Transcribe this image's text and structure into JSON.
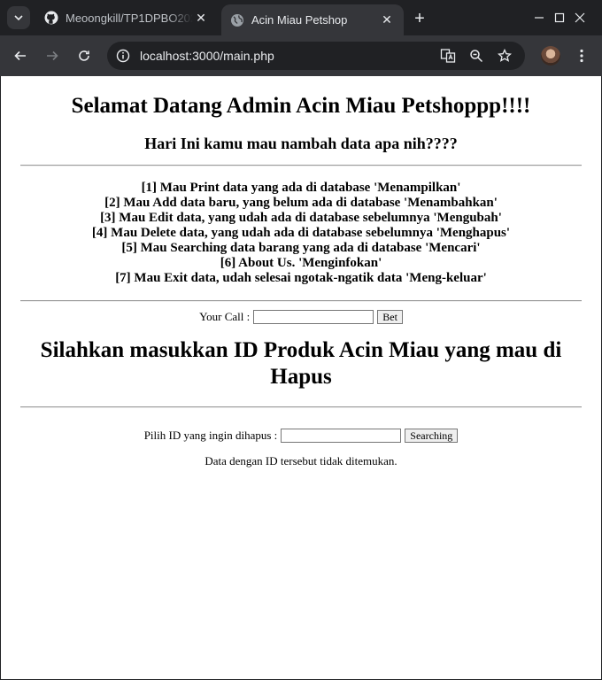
{
  "browser": {
    "tabs": [
      {
        "title": "Meoongkill/TP1DPBO2025",
        "active": false
      },
      {
        "title": "Acin Miau Petshop",
        "active": true
      }
    ],
    "url": "localhost:3000/main.php"
  },
  "page": {
    "title": "Selamat Datang Admin Acin Miau Petshoppp!!!!",
    "subtitle": "Hari Ini kamu mau nambah data apa nih????",
    "menu_items": [
      "[1] Mau Print data yang ada di database 'Menampilkan'",
      "[2] Mau Add data baru, yang belum ada di database 'Menambahkan'",
      "[3] Mau Edit data, yang udah ada di database sebelumnya 'Mengubah'",
      "[4] Mau Delete data, yang udah ada di database sebelumnya 'Menghapus'",
      "[5] Mau Searching data barang yang ada di database 'Mencari'",
      "[6] About Us. 'Menginfokan'",
      "[7] Mau Exit data, udah selesai ngotak-ngatik data 'Meng-keluar'"
    ],
    "call": {
      "label": "Your Call :",
      "value": "",
      "button": "Bet"
    },
    "delete_heading": "Silahkan masukkan ID Produk Acin Miau yang mau di Hapus",
    "delete": {
      "label": "Pilih ID yang ingin dihapus :",
      "value": "",
      "button": "Searching"
    },
    "message": "Data dengan ID tersebut tidak ditemukan."
  }
}
